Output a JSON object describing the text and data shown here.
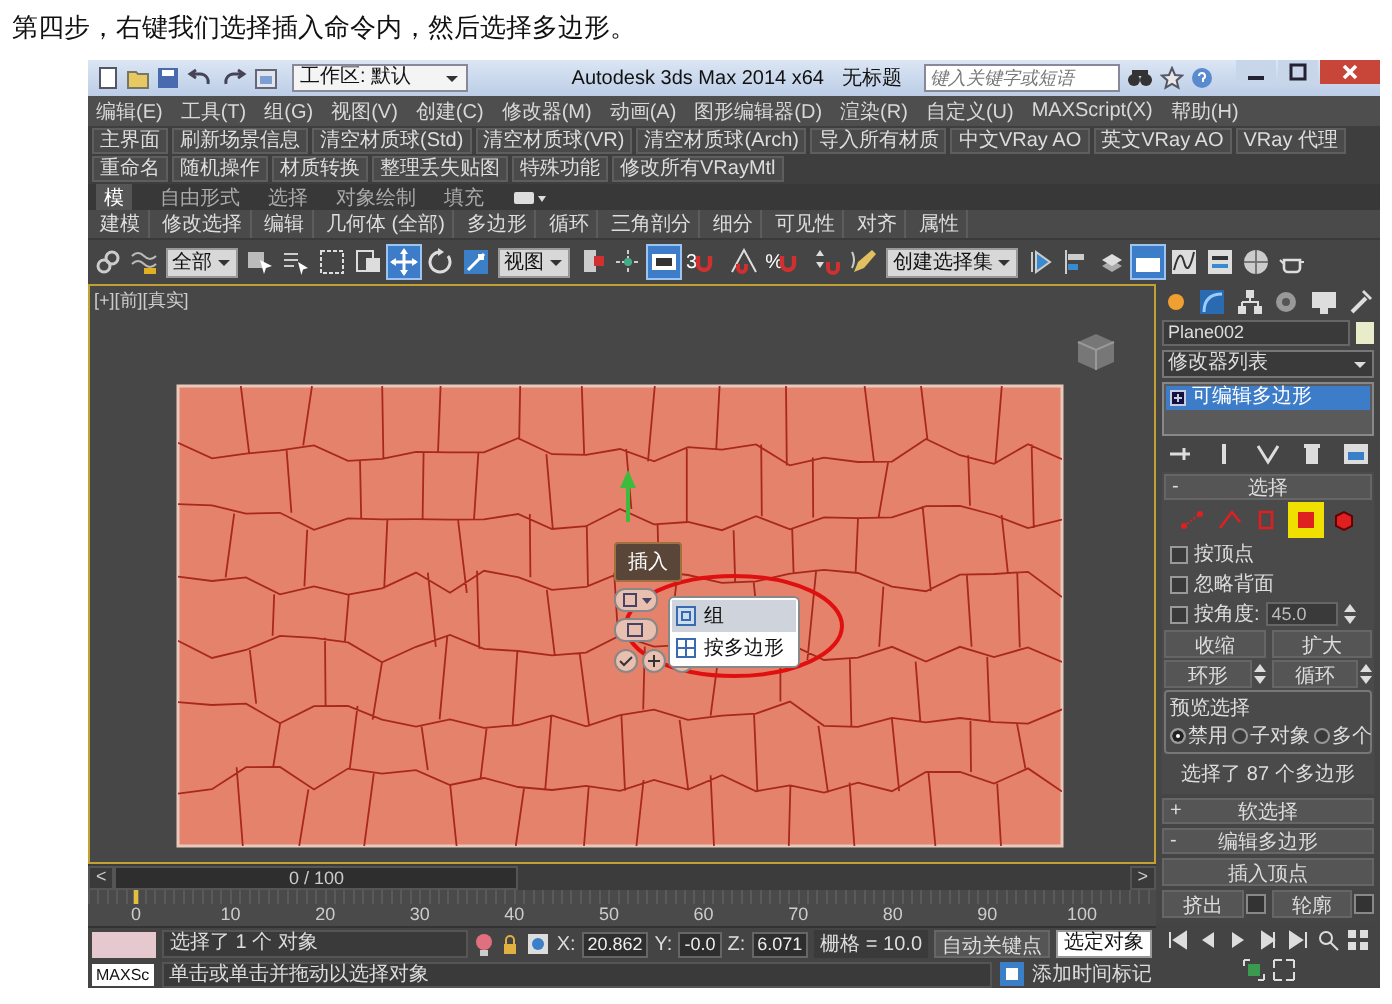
{
  "caption": "第四步，右键我们选择插入命令内，然后选择多边形。",
  "title_bar": {
    "workspace": "工作区: 默认",
    "app_title": "Autodesk 3ds Max 2014 x64",
    "document": "无标题",
    "search_placeholder": "键入关键字或短语"
  },
  "menu": [
    "编辑(E)",
    "工具(T)",
    "组(G)",
    "视图(V)",
    "创建(C)",
    "修改器(M)",
    "动画(A)",
    "图形编辑器(D)",
    "渲染(R)",
    "自定义(U)",
    "MAXScript(X)",
    "帮助(H)"
  ],
  "plugin_bar": [
    "主界面",
    "刷新场景信息",
    "清空材质球(Std)",
    "清空材质球(VR)",
    "清空材质球(Arch)",
    "导入所有材质",
    "中文VRay AO",
    "英文VRay AO",
    "VRay 代理",
    "重命名",
    "随机操作",
    "材质转换",
    "整理丢失贴图",
    "特殊功能",
    "修改所有VRayMtl"
  ],
  "ribbon_tabs": [
    {
      "label": "模",
      "selected": true
    },
    {
      "label": "自由形式",
      "selected": false
    },
    {
      "label": "选择",
      "selected": false
    },
    {
      "label": "对象绘制",
      "selected": false
    },
    {
      "label": "填充",
      "selected": false
    }
  ],
  "ribbon_panels": [
    "建模",
    "修改选择",
    "编辑",
    "几何体 (全部)",
    "多边形",
    "循环",
    "三角剖分",
    "细分",
    "可见性",
    "对齐",
    "属性"
  ],
  "toolbar": [
    {
      "kind": "link",
      "selected": false
    },
    {
      "kind": "bind",
      "selected": false
    },
    {
      "kind": "dropdown",
      "value": "全部"
    },
    {
      "kind": "select",
      "selected": false
    },
    {
      "kind": "select-by-name",
      "selected": false
    },
    {
      "kind": "rect-region",
      "selected": false
    },
    {
      "kind": "window-crossing",
      "selected": false
    },
    {
      "kind": "move",
      "selected": true
    },
    {
      "kind": "rotate",
      "selected": false
    },
    {
      "kind": "scale",
      "selected": false
    },
    {
      "kind": "dropdown",
      "value": "视图"
    },
    {
      "kind": "pivot",
      "selected": false
    },
    {
      "kind": "manipulate",
      "selected": false
    },
    {
      "kind": "keyboard",
      "selected": true
    },
    {
      "kind": "snap",
      "label": "3",
      "selected": false
    },
    {
      "kind": "angle-snap",
      "selected": false
    },
    {
      "kind": "snap",
      "label": "%",
      "selected": false
    },
    {
      "kind": "spinner-snap",
      "selected": false
    },
    {
      "kind": "edit-sets",
      "selected": false
    },
    {
      "kind": "dropdown",
      "value": "创建选择集"
    },
    {
      "kind": "mirror",
      "selected": false
    },
    {
      "kind": "align",
      "selected": false
    },
    {
      "kind": "layers",
      "selected": false
    },
    {
      "kind": "ribbon",
      "selected": true
    },
    {
      "kind": "curve-editor",
      "selected": false
    },
    {
      "kind": "schematic",
      "selected": false
    },
    {
      "kind": "material",
      "selected": false
    },
    {
      "kind": "render-setup",
      "selected": false
    }
  ],
  "viewport": {
    "label": "[+][前][真实]",
    "quad_menu": {
      "title": "插入",
      "submenu": [
        {
          "label": "组",
          "selected": true
        },
        {
          "label": "按多边形",
          "selected": false
        }
      ]
    }
  },
  "command_panel": {
    "object_name": "Plane002",
    "modifier_list": "修改器列表",
    "stack": [
      {
        "label": "可编辑多边形",
        "selected": true
      }
    ],
    "selection": {
      "toggle": "-",
      "title": "选择",
      "levels": [
        {
          "kind": "vertex",
          "selected": false
        },
        {
          "kind": "edge",
          "selected": false
        },
        {
          "kind": "border",
          "selected": false
        },
        {
          "kind": "polygon",
          "selected": true
        },
        {
          "kind": "element",
          "selected": false
        }
      ],
      "checkboxes": [
        {
          "label": "按顶点",
          "checked": false
        },
        {
          "label": "忽略背面",
          "checked": false
        },
        {
          "label": "按角度:",
          "checked": false,
          "value": "45.0"
        }
      ],
      "buttons": [
        "收缩",
        "扩大"
      ],
      "spin_buttons": [
        "环形",
        "循环"
      ],
      "preview": {
        "title": "预览选择",
        "options": [
          {
            "label": "禁用",
            "selected": true
          },
          {
            "label": "子对象",
            "selected": false
          },
          {
            "label": "多个",
            "selected": false
          }
        ]
      },
      "status": "选择了 87 个多边形"
    },
    "rollouts": [
      {
        "toggle": "+",
        "title": "软选择"
      },
      {
        "toggle": "-",
        "title": "编辑多边形"
      }
    ],
    "insert_vertex": "插入顶点",
    "operations": [
      "挤出",
      "轮廓"
    ]
  },
  "time_slider": {
    "prev": "<",
    "label": "0 / 100",
    "level": 0,
    "next": ">"
  },
  "track_ticks": [
    "0",
    "10",
    "20",
    "30",
    "40",
    "50",
    "60",
    "70",
    "80",
    "90",
    "100"
  ],
  "status_bar": {
    "listener": "MAXSc",
    "selection": "选择了 1 个 对象",
    "coords": [
      {
        "label": "X:",
        "value": "20.862"
      },
      {
        "label": "Y:",
        "value": "-0.0"
      },
      {
        "label": "Z:",
        "value": "6.071"
      }
    ],
    "grid": "栅格 = 10.0",
    "auto_key": "自动关键点",
    "key_filter": "选定对象",
    "prompt": "单击或单击并拖动以选择对象",
    "time_tag": "添加时间标记"
  }
}
